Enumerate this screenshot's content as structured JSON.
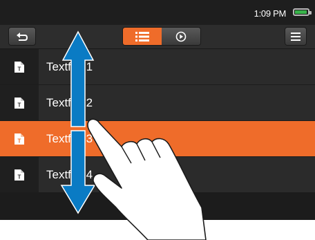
{
  "status": {
    "time": "1:09 PM",
    "battery_icon": "battery-icon"
  },
  "toolbar": {
    "back_icon": "back-arrow-icon",
    "list_view_icon": "list-view-icon",
    "play_icon": "play-icon",
    "menu_icon": "menu-icon",
    "accent": "#ef6c2a"
  },
  "list": {
    "items": [
      {
        "label": "Textfile 1",
        "selected": false
      },
      {
        "label": "Textfile 2",
        "selected": false
      },
      {
        "label": "Textfile 3",
        "selected": true
      },
      {
        "label": "Textfile 4",
        "selected": false
      }
    ]
  },
  "gesture": {
    "arrow_color": "#0a7bc4",
    "hand_icon": "hand-swipe-icon"
  }
}
